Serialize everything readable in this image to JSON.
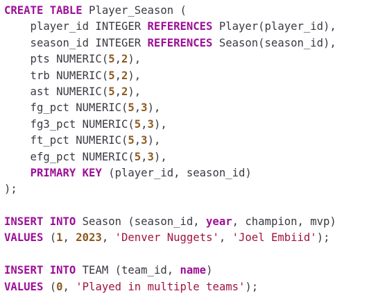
{
  "code": {
    "lines": [
      [
        {
          "t": "kw",
          "v": "CREATE TABLE"
        },
        {
          "t": "plain",
          "v": " Player_Season ("
        }
      ],
      [
        {
          "t": "plain",
          "v": "    player_id INTEGER "
        },
        {
          "t": "kw",
          "v": "REFERENCES"
        },
        {
          "t": "plain",
          "v": " Player(player_id),"
        }
      ],
      [
        {
          "t": "plain",
          "v": "    season_id INTEGER "
        },
        {
          "t": "kw",
          "v": "REFERENCES"
        },
        {
          "t": "plain",
          "v": " Season(season_id),"
        }
      ],
      [
        {
          "t": "plain",
          "v": "    pts NUMERIC("
        },
        {
          "t": "num",
          "v": "5"
        },
        {
          "t": "plain",
          "v": ","
        },
        {
          "t": "num",
          "v": "2"
        },
        {
          "t": "plain",
          "v": "),"
        }
      ],
      [
        {
          "t": "plain",
          "v": "    trb NUMERIC("
        },
        {
          "t": "num",
          "v": "5"
        },
        {
          "t": "plain",
          "v": ","
        },
        {
          "t": "num",
          "v": "2"
        },
        {
          "t": "plain",
          "v": "),"
        }
      ],
      [
        {
          "t": "plain",
          "v": "    ast NUMERIC("
        },
        {
          "t": "num",
          "v": "5"
        },
        {
          "t": "plain",
          "v": ","
        },
        {
          "t": "num",
          "v": "2"
        },
        {
          "t": "plain",
          "v": "),"
        }
      ],
      [
        {
          "t": "plain",
          "v": "    fg_pct NUMERIC("
        },
        {
          "t": "num",
          "v": "5"
        },
        {
          "t": "plain",
          "v": ","
        },
        {
          "t": "num",
          "v": "3"
        },
        {
          "t": "plain",
          "v": "),"
        }
      ],
      [
        {
          "t": "plain",
          "v": "    fg3_pct NUMERIC("
        },
        {
          "t": "num",
          "v": "5"
        },
        {
          "t": "plain",
          "v": ","
        },
        {
          "t": "num",
          "v": "3"
        },
        {
          "t": "plain",
          "v": "),"
        }
      ],
      [
        {
          "t": "plain",
          "v": "    ft_pct NUMERIC("
        },
        {
          "t": "num",
          "v": "5"
        },
        {
          "t": "plain",
          "v": ","
        },
        {
          "t": "num",
          "v": "3"
        },
        {
          "t": "plain",
          "v": "),"
        }
      ],
      [
        {
          "t": "plain",
          "v": "    efg_pct NUMERIC("
        },
        {
          "t": "num",
          "v": "5"
        },
        {
          "t": "plain",
          "v": ","
        },
        {
          "t": "num",
          "v": "3"
        },
        {
          "t": "plain",
          "v": "),"
        }
      ],
      [
        {
          "t": "plain",
          "v": "    "
        },
        {
          "t": "kw",
          "v": "PRIMARY KEY"
        },
        {
          "t": "plain",
          "v": " (player_id, season_id)"
        }
      ],
      [
        {
          "t": "plain",
          "v": ");"
        }
      ],
      [],
      [
        {
          "t": "kw",
          "v": "INSERT INTO"
        },
        {
          "t": "plain",
          "v": " Season (season_id, "
        },
        {
          "t": "kw",
          "v": "year"
        },
        {
          "t": "plain",
          "v": ", champion, mvp)"
        }
      ],
      [
        {
          "t": "kw",
          "v": "VALUES"
        },
        {
          "t": "plain",
          "v": " ("
        },
        {
          "t": "num",
          "v": "1"
        },
        {
          "t": "plain",
          "v": ", "
        },
        {
          "t": "num",
          "v": "2023"
        },
        {
          "t": "plain",
          "v": ", "
        },
        {
          "t": "str",
          "v": "'Denver Nuggets'"
        },
        {
          "t": "plain",
          "v": ", "
        },
        {
          "t": "str",
          "v": "'Joel Embiid'"
        },
        {
          "t": "plain",
          "v": ");"
        }
      ],
      [],
      [
        {
          "t": "kw",
          "v": "INSERT INTO"
        },
        {
          "t": "plain",
          "v": " TEAM (team_id, "
        },
        {
          "t": "kw",
          "v": "name"
        },
        {
          "t": "plain",
          "v": ")"
        }
      ],
      [
        {
          "t": "kw",
          "v": "VALUES"
        },
        {
          "t": "plain",
          "v": " ("
        },
        {
          "t": "num",
          "v": "0"
        },
        {
          "t": "plain",
          "v": ", "
        },
        {
          "t": "str",
          "v": "'Played in multiple teams'"
        },
        {
          "t": "plain",
          "v": ");"
        }
      ]
    ]
  },
  "colors": {
    "background": "#ffffff",
    "keyword": "#9d0f98",
    "number": "#8c5a20",
    "string": "#a0153e",
    "text": "#383a42"
  }
}
